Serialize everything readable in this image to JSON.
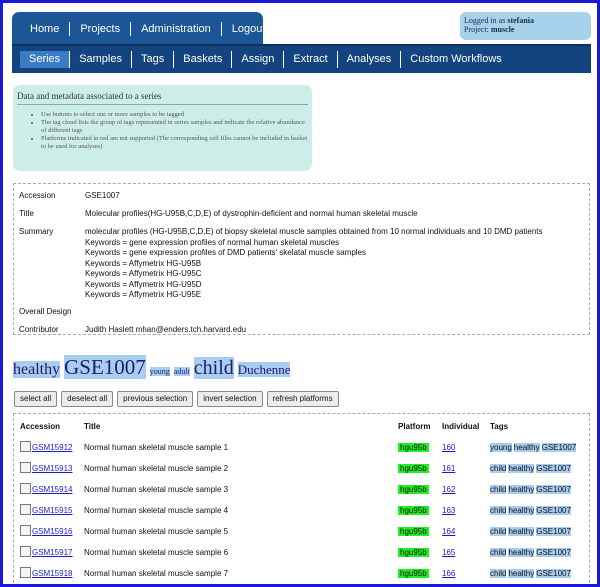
{
  "topnav": [
    "Home",
    "Projects",
    "Administration",
    "Logout"
  ],
  "user": {
    "logged_label": "Logged in as ",
    "user_name": "stefania",
    "project_label": "Project: ",
    "project_name": "muscle"
  },
  "subnav": [
    "Series",
    "Samples",
    "Tags",
    "Baskets",
    "Assign",
    "Extract",
    "Analyses",
    "Custom Workflows"
  ],
  "info": {
    "heading": "Data and metadata associated to a series",
    "bullets": [
      "Use buttons to select one or more samples to be tagged",
      "The tag cloud lists the group of tags represented in series samples and indicate the relative abundance of different tags",
      "Platforms indicated in red are not supported (The corresponding cell files cannot be included in basket to be used for analyses)"
    ]
  },
  "details": {
    "accession_label": "Accession",
    "accession": "GSE1007",
    "title_label": "Title",
    "title": "Molecular profiles(HG-U95B,C,D,E) of dystrophin-deficient and normal human skeletal muscle",
    "summary_label": "Summary",
    "summary": [
      "molecular profiles (HG-U95B,C,D,E) of biopsy skeletal muscle samples obtained from 10 normal individuals and 10 DMD patients",
      "Keywords = gene expression profiles of normal human skeletal muscles",
      "Keywords = gene expression profiles of DMD patients' skelatal muscle samples",
      "Keywords = Affymetrix HG-U95B",
      "Keywords = Affymetrix HG-U95C",
      "Keywords = Affymetrix HG-U95D",
      "Keywords = Affymetrix HG-U95E"
    ],
    "design_label": "Overall Design",
    "contributor_label": "Contributor",
    "contributor": "Judith Haslett mhan@enders.tch.harvard.edu"
  },
  "cloud": [
    "healthy",
    "GSE1007",
    "young",
    "adult",
    "child",
    "Duchenne"
  ],
  "buttons": [
    "select all",
    "deselect all",
    "previous selection",
    "invert selection",
    "refresh platforms"
  ],
  "table": {
    "headers": [
      "Accession",
      "Title",
      "Platform",
      "Individual",
      "Tags"
    ],
    "rows": [
      {
        "acc": "GSM15912",
        "title": "Normal human skeletal muscle sample 1",
        "platform": "hgu95b",
        "individual": "160",
        "tags": [
          "young",
          "healthy",
          "GSE1007"
        ]
      },
      {
        "acc": "GSM15913",
        "title": "Normal human skeletal muscle sample 2",
        "platform": "hgu95b",
        "individual": "161",
        "tags": [
          "child",
          "healthy",
          "GSE1007"
        ]
      },
      {
        "acc": "GSM15914",
        "title": "Normal human skeletal muscle sample 3",
        "platform": "hgu95b",
        "individual": "162",
        "tags": [
          "child",
          "healthy",
          "GSE1007"
        ]
      },
      {
        "acc": "GSM15915",
        "title": "Normal human skeletal muscle sample 4",
        "platform": "hgu95b",
        "individual": "163",
        "tags": [
          "child",
          "healthy",
          "GSE1007"
        ]
      },
      {
        "acc": "GSM15916",
        "title": "Normal human skeletal muscle sample 5",
        "platform": "hgu95b",
        "individual": "164",
        "tags": [
          "child",
          "healthy",
          "GSE1007"
        ]
      },
      {
        "acc": "GSM15917",
        "title": "Normal human skeletal muscle sample 6",
        "platform": "hgu95b",
        "individual": "165",
        "tags": [
          "child",
          "healthy",
          "GSE1007"
        ]
      },
      {
        "acc": "GSM15918",
        "title": "Normal human skeletal muscle sample 7",
        "platform": "hgu95b",
        "individual": "166",
        "tags": [
          "child",
          "healthy",
          "GSE1007"
        ]
      }
    ]
  },
  "colors": {
    "frame": "#1a1ad6",
    "nav": "#1d5696",
    "subnav": "#14447f",
    "info_bg": "#cdeee8",
    "tag_bg": "#a8cdf0",
    "platform_ok": "#22ee22"
  }
}
